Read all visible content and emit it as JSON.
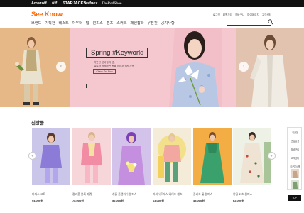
{
  "topbar": {
    "brands": [
      {
        "label": "Amazoff"
      },
      {
        "label": "tiff"
      },
      {
        "label": "STARJACKS"
      },
      {
        "label": "ssfnex"
      },
      {
        "label": "TheRedShoe"
      }
    ]
  },
  "header": {
    "logo": "See Know",
    "utils": [
      "로그인",
      "회원가입",
      "장바구니",
      "마이페이지",
      "고객센터"
    ],
    "menu": [
      "브랜드",
      "기획전",
      "베스트",
      "아우터",
      "탑",
      "원피스",
      "팬츠",
      "스커트",
      "패션잡화",
      "우븐핏",
      "공지사항"
    ]
  },
  "hero": {
    "title": "Spring #Keyworld",
    "sub_lines": [
      "따뜻한 봄바람의 봄,",
      "질로와 함께하면 봄을 따라온 설렘가득"
    ],
    "cta": "Check Out Now",
    "prev_icon": "‹",
    "next_icon": "›"
  },
  "new_arrivals": {
    "title": "신상품",
    "prev_icon": "‹",
    "next_icon": "›",
    "items": [
      {
        "name": "파파스 코트",
        "price": "94,000원"
      },
      {
        "name": "컬러풀 블록 자켓",
        "price": "78,000원"
      },
      {
        "name": "쉬폰 플랩카디 원피스",
        "price": "52,000원"
      },
      {
        "name": "파이더트레스 와이드 팬츠",
        "price": "63,000원"
      },
      {
        "name": "플리츠 롱 원피스",
        "price": "45,000원"
      },
      {
        "name": "양끈 셔츠 원피스",
        "price": "62,000원"
      }
    ]
  },
  "sidebar": {
    "items": [
      "최근본",
      "관심상품",
      "장바구니",
      "고객센터",
      "최근본상품"
    ],
    "top_label": "TOP"
  },
  "colors": {
    "accent": "#ff6600",
    "topbar": "#111111"
  }
}
